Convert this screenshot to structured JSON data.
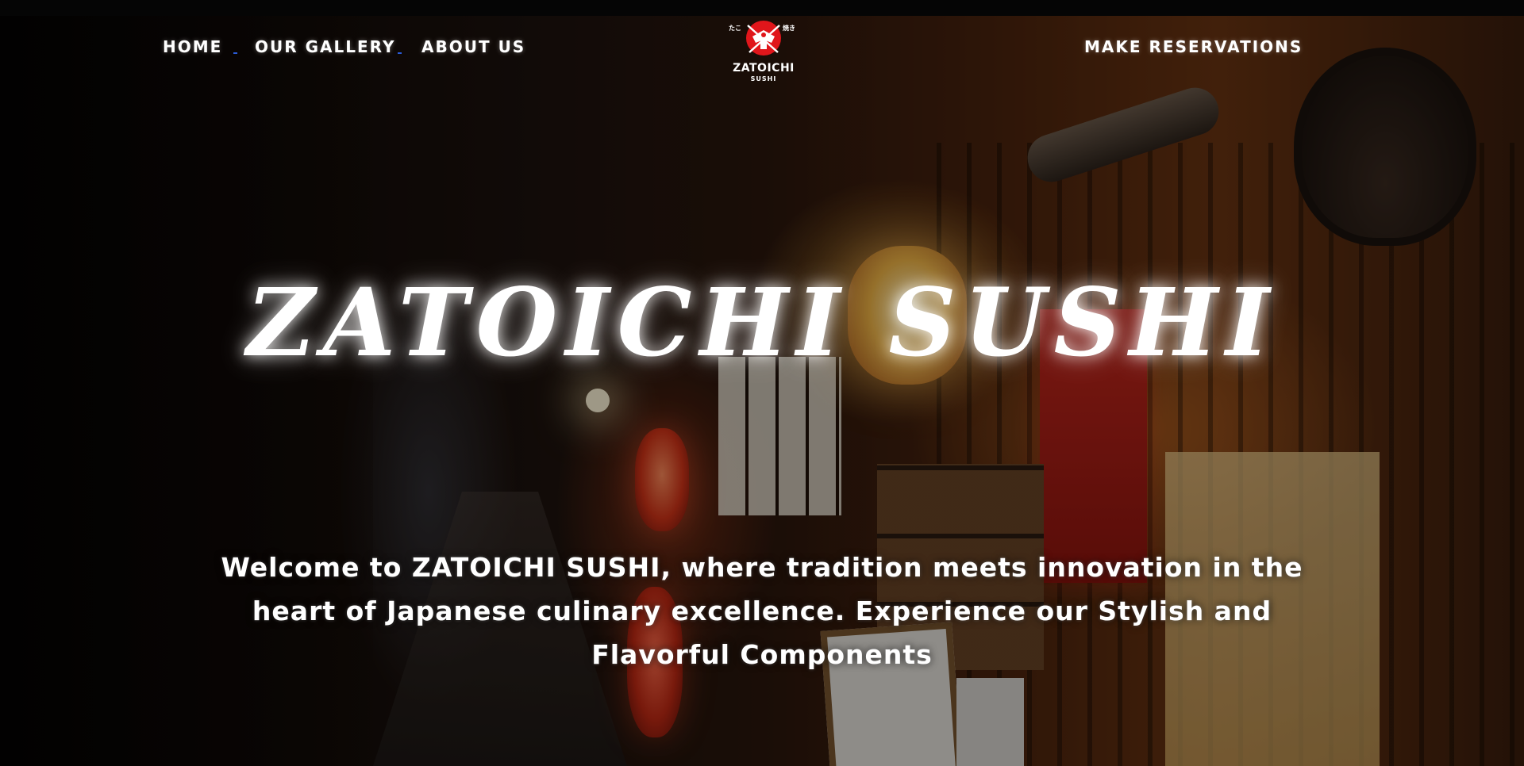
{
  "nav": {
    "links": [
      {
        "label": "HOME"
      },
      {
        "label": "OUR GALLERY"
      },
      {
        "label": "ABOUT US"
      }
    ],
    "cta_label": "MAKE RESERVATIONS"
  },
  "logo": {
    "name": "ZATOICHI",
    "sub": "SUSHI",
    "left_mark": "たこ",
    "right_mark": "焼き",
    "brand_color": "#e0161b"
  },
  "hero": {
    "title": "ZATOICHI SUSHI",
    "tagline": "Welcome to ZATOICHI SUSHI, where tradition meets innovation in the heart of Japanese culinary excellence. Experience our Stylish and Flavorful Components"
  },
  "theme": {
    "text_color": "#ffffff",
    "separator_color": "#2a5bd7"
  }
}
